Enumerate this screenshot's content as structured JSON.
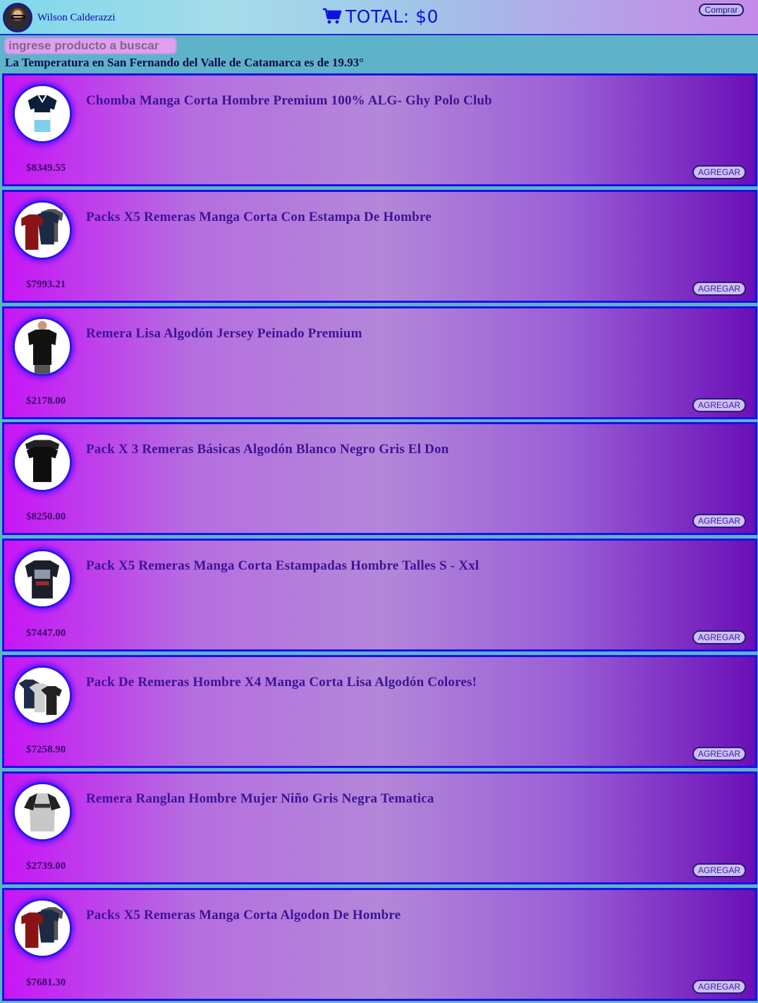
{
  "header": {
    "user_name": "Wilson Calderazzi",
    "avatar_icon": "user-avatar",
    "cart_icon": "shopping-cart-icon",
    "total_label": "TOTAL: $0",
    "buy_label": "Comprar"
  },
  "search": {
    "placeholder": "ingrese producto a buscar",
    "value": ""
  },
  "weather": {
    "text": "La Temperatura en San Fernando del Valle de Catamarca es de 19.93°"
  },
  "colors": {
    "accent_blue": "#1a10e8",
    "card_gradient_start": "#c816f6",
    "card_gradient_end": "#6b0fb7",
    "page_background": "#5fb3c9"
  },
  "products": [
    {
      "title": "Chomba Manga Corta Hombre Premium 100% ALG- Ghy Polo Club",
      "price": "$8349.55",
      "button": "AGREGAR",
      "image": "polo-shirt-image"
    },
    {
      "title": "Packs X5 Remeras Manga Corta Con Estampa De Hombre",
      "price": "$7993.21",
      "button": "AGREGAR",
      "image": "tshirt-pack-image"
    },
    {
      "title": "Remera Lisa Algodón Jersey Peinado Premium",
      "price": "$2178.00",
      "button": "AGREGAR",
      "image": "black-tshirt-model-image"
    },
    {
      "title": "Pack X 3 Remeras Básicas Algodón Blanco Negro Gris El Don",
      "price": "$8250.00",
      "button": "AGREGAR",
      "image": "basic-tshirts-image"
    },
    {
      "title": "Pack X5 Remeras Manga Corta Estampadas Hombre Talles S - Xxl",
      "price": "$7447.00",
      "button": "AGREGAR",
      "image": "printed-tshirt-image"
    },
    {
      "title": "Pack De Remeras Hombre X4 Manga Corta Lisa Algodón Colores!",
      "price": "$7258.90",
      "button": "AGREGAR",
      "image": "four-tshirts-image"
    },
    {
      "title": "Remera Ranglan Hombre Mujer Niño Gris Negra Tematica",
      "price": "$2739.00",
      "button": "AGREGAR",
      "image": "raglan-tshirt-image"
    },
    {
      "title": "Packs X5 Remeras Manga Corta Algodon De Hombre",
      "price": "$7681.30",
      "button": "AGREGAR",
      "image": "tshirt-pack-image"
    }
  ]
}
